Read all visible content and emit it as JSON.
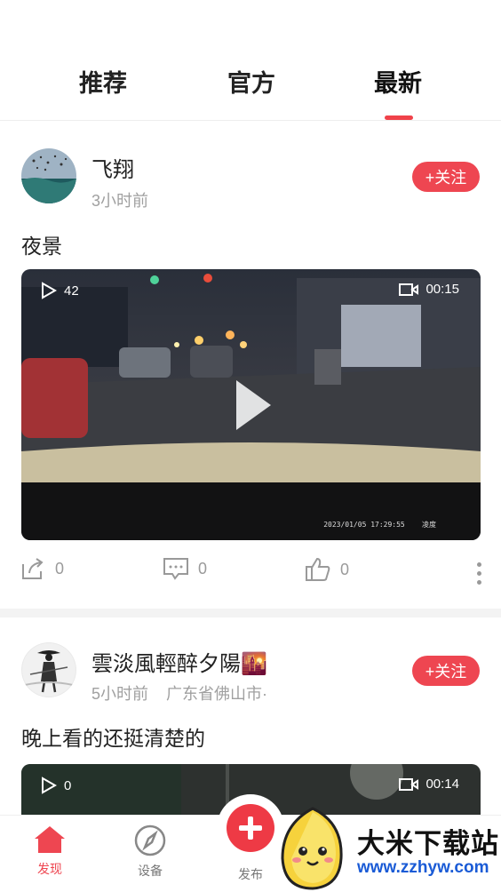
{
  "tabs": [
    {
      "label": "推荐",
      "active": false
    },
    {
      "label": "官方",
      "active": false
    },
    {
      "label": "最新",
      "active": true
    }
  ],
  "accent_color": "#ee4651",
  "posts": [
    {
      "user_name": "飞翔",
      "time": "3小时前",
      "location": "",
      "follow_label": "+关注",
      "caption": "夜景",
      "video": {
        "views": "42",
        "duration": "00:15",
        "stamp": "2023/01/05 17:29:55",
        "stamp_tag": "凌度"
      },
      "share_count": "0",
      "comment_count": "0",
      "like_count": "0"
    },
    {
      "user_name": "雲淡風輕醉夕陽🌇",
      "time": "5小时前",
      "location": "广东省佛山市·",
      "follow_label": "+关注",
      "caption": "晚上看的还挺清楚的",
      "video": {
        "views": "0",
        "duration": "00:14"
      }
    }
  ],
  "bottom_nav": [
    {
      "label": "发现",
      "icon": "home-icon",
      "active": true
    },
    {
      "label": "设备",
      "icon": "compass-icon",
      "active": false
    },
    {
      "label": "发布",
      "icon": "plus-icon",
      "active": false
    }
  ],
  "watermark": {
    "title": "大米下载站",
    "url": "www.zzhyw.com"
  }
}
